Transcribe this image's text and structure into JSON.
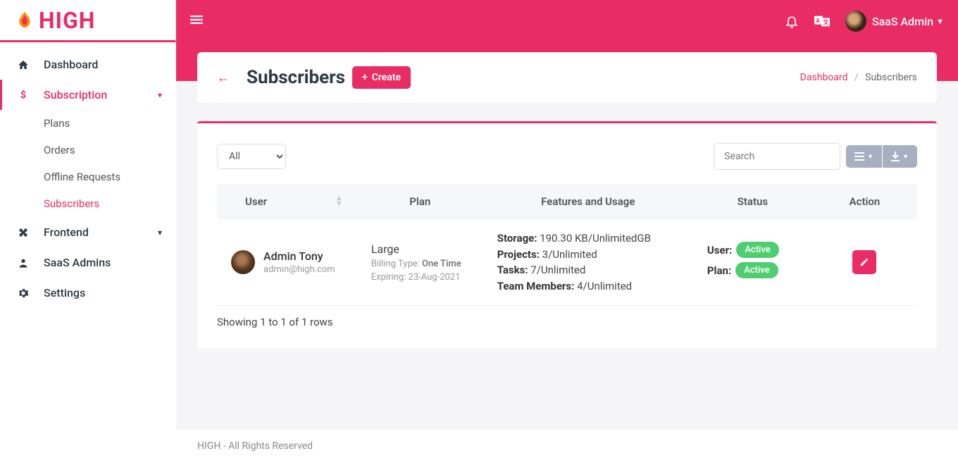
{
  "logo": {
    "text": "HIGH"
  },
  "sidebar": {
    "items": [
      {
        "icon": "home",
        "label": "Dashboard"
      },
      {
        "icon": "dollar",
        "label": "Subscription",
        "expandable": true,
        "active": true
      },
      {
        "icon": "puzzle",
        "label": "Frontend",
        "expandable": true
      },
      {
        "icon": "users",
        "label": "SaaS Admins"
      },
      {
        "icon": "gear",
        "label": "Settings"
      }
    ],
    "subitems": [
      {
        "label": "Plans"
      },
      {
        "label": "Orders"
      },
      {
        "label": "Offline Requests"
      },
      {
        "label": "Subscribers",
        "active": true
      }
    ]
  },
  "topbar": {
    "user_name": "SaaS Admin"
  },
  "page": {
    "title": "Subscribers",
    "create_label": "Create",
    "breadcrumb_home": "Dashboard",
    "breadcrumb_current": "Subscribers"
  },
  "toolbar": {
    "filter_value": "All",
    "search_placeholder": "Search"
  },
  "table": {
    "headers": {
      "user": "User",
      "plan": "Plan",
      "features": "Features and Usage",
      "status": "Status",
      "action": "Action"
    },
    "rows": [
      {
        "user_name": "Admin Tony",
        "user_email": "admin@high.com",
        "plan_name": "Large",
        "billing_label": "Billing Type: ",
        "billing_value": "One Time",
        "expiring_label": "Expiring: ",
        "expiring_value": "23-Aug-2021",
        "storage_label": "Storage:",
        "storage_value": " 190.30 KB/UnlimitedGB",
        "projects_label": "Projects:",
        "projects_value": " 3/Unlimited",
        "tasks_label": "Tasks:",
        "tasks_value": " 7/Unlimited",
        "members_label": "Team Members:",
        "members_value": " 4/Unlimited",
        "status_user_label": "User:",
        "status_user_value": "Active",
        "status_plan_label": "Plan:",
        "status_plan_value": "Active"
      }
    ],
    "pagination_info": "Showing 1 to 1 of 1 rows"
  },
  "footer": {
    "text": "HIGH - All Rights Reserved"
  }
}
